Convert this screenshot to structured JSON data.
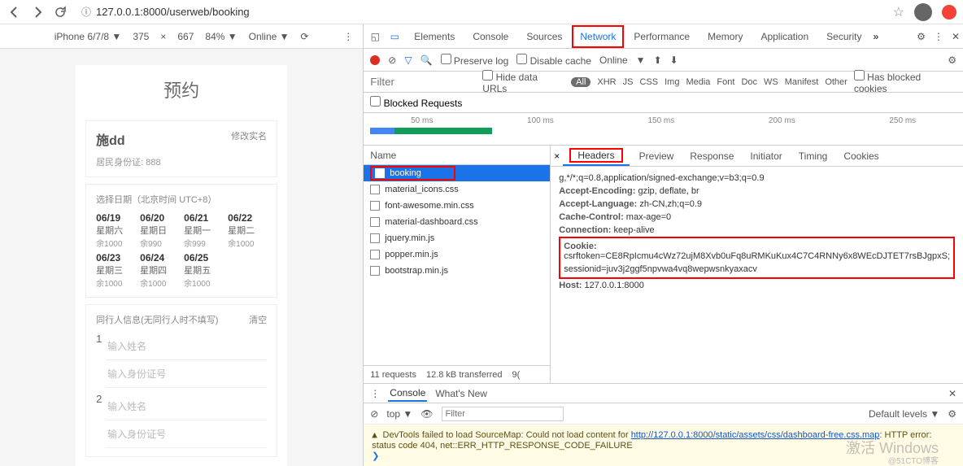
{
  "browser": {
    "url_prefix": "ⓘ",
    "url": "127.0.0.1:8000/userweb/booking",
    "star_icon": "☆"
  },
  "device_bar": {
    "device": "iPhone 6/7/8 ▼",
    "width": "375",
    "times": "×",
    "height": "667",
    "zoom": "84% ▼",
    "network": "Online ▼"
  },
  "page": {
    "title": "预约",
    "user_name": "施dd",
    "edit_label": "修改实名",
    "id_label": "居民身份证:",
    "id_value": "888",
    "date_head": "选择日期（北京时间 UTC+8）",
    "days": [
      {
        "d": "06/19",
        "w": "星期六",
        "r": "余1000"
      },
      {
        "d": "06/20",
        "w": "星期日",
        "r": "余990"
      },
      {
        "d": "06/21",
        "w": "星期一",
        "r": "余999"
      },
      {
        "d": "06/22",
        "w": "星期二",
        "r": "余1000"
      },
      {
        "d": "06/23",
        "w": "星期三",
        "r": "余1000"
      },
      {
        "d": "06/24",
        "w": "星期四",
        "r": "余1000"
      },
      {
        "d": "06/25",
        "w": "星期五",
        "r": "余1000"
      }
    ],
    "companion_head": "同行人信息(无同行人时不填写)",
    "clear_label": "清空",
    "name_ph": "输入姓名",
    "id_ph": "输入身份证号"
  },
  "devtools": {
    "tabs": [
      "Elements",
      "Console",
      "Sources",
      "Network",
      "Performance",
      "Memory",
      "Application",
      "Security"
    ],
    "active_tab": "Network",
    "preserve": "Preserve log",
    "disable_cache": "Disable cache",
    "online": "Online",
    "filter_ph": "Filter",
    "hide_urls": "Hide data URLs",
    "types": [
      "All",
      "XHR",
      "JS",
      "CSS",
      "Img",
      "Media",
      "Font",
      "Doc",
      "WS",
      "Manifest",
      "Other"
    ],
    "blocked_cb": "Has blocked cookies",
    "blocked_req": "Blocked Requests",
    "times": [
      "50 ms",
      "100 ms",
      "150 ms",
      "200 ms",
      "250 ms"
    ],
    "name_col": "Name",
    "requests": [
      "booking",
      "material_icons.css",
      "font-awesome.min.css",
      "material-dashboard.css",
      "jquery.min.js",
      "popper.min.js",
      "bootstrap.min.js"
    ],
    "status": {
      "req": "11 requests",
      "size": "12.8 kB transferred",
      "res": "9("
    },
    "detail_tabs": [
      "Headers",
      "Preview",
      "Response",
      "Initiator",
      "Timing",
      "Cookies"
    ],
    "headers": [
      {
        "k": "",
        "v": "g,*/*;q=0.8,application/signed-exchange;v=b3;q=0.9"
      },
      {
        "k": "Accept-Encoding:",
        "v": "gzip, deflate, br"
      },
      {
        "k": "Accept-Language:",
        "v": "zh-CN,zh;q=0.9"
      },
      {
        "k": "Cache-Control:",
        "v": "max-age=0"
      },
      {
        "k": "Connection:",
        "v": "keep-alive"
      }
    ],
    "cookie_k": "Cookie:",
    "cookie_v1": "csrftoken=CE8RpIcmu4cWz72ujM8Xvb0uFq8uRMKuKux4C7C4RNNy6x8WEcDJTET7rsBJgpxS;",
    "cookie_v2": "sessionid=juv3j2ggf5npvwa4vq8wepwsnkyaxacv",
    "host_k": "Host:",
    "host_v": "127.0.0.1:8000",
    "console_tab": "Console",
    "whats_new": "What's New",
    "top": "top ▼",
    "levels": "Default levels ▼",
    "warn1": "DevTools failed to load SourceMap: Could not load content for ",
    "warn_link": "http://127.0.0.1:8000/static/assets/css/dashboard-free.css.map",
    "warn2": ": HTTP error: status code 404, net::ERR_HTTP_RESPONSE_CODE_FAILURE"
  },
  "watermark": "激活 Windows",
  "watermark_corner": "@51CTO博客"
}
